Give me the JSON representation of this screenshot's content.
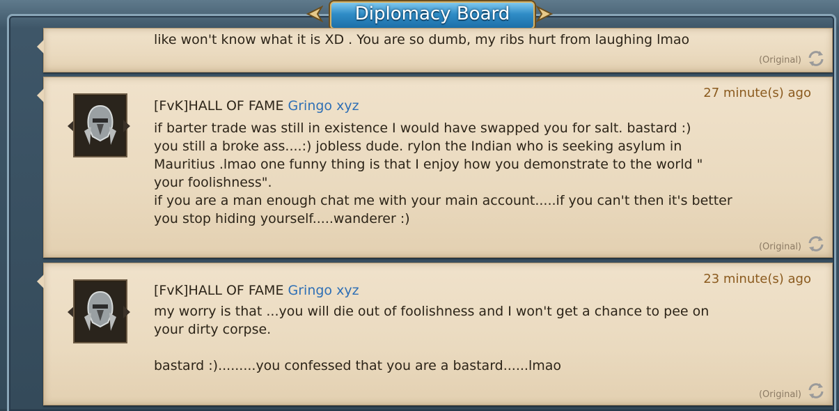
{
  "header": {
    "title": "Diplomacy Board"
  },
  "messages": [
    {
      "body": "like won't know what it is XD . You are so dumb, my ribs hurt from laughing lmao",
      "original_label": "(Original)"
    },
    {
      "tag": "[FvK]HALL OF FAME",
      "name": "Gringo xyz",
      "time": "27 minute(s) ago",
      "body": "if barter trade was still in existence I would have swapped you for salt. bastard :)\nyou still a broke ass....:) jobless dude. rylon the Indian who is seeking asylum in\nMauritius .lmao one funny thing is that I enjoy how you demonstrate to the world \"\nyour foolishness\".\nif you are a man enough chat me with your main account.....if you can't then it's better\nyou stop hiding yourself.....wanderer :)",
      "original_label": "(Original)"
    },
    {
      "tag": "[FvK]HALL OF FAME",
      "name": "Gringo xyz",
      "time": "23 minute(s) ago",
      "body": "my worry is that ...you will die out of foolishness and I won't get a chance to pee on\nyour dirty corpse.\n\nbastard :).........you confessed that you are a bastard......lmao",
      "original_label": "(Original)"
    }
  ],
  "colors": {
    "name": "#2e6fb5",
    "time": "#8a5a1e",
    "parchment": "#eadabf",
    "header_blue": "#2f8cc6"
  },
  "icons": [
    "chevron-left-icon",
    "chevron-right-icon",
    "knight-helmet-avatar",
    "refresh-icon"
  ]
}
